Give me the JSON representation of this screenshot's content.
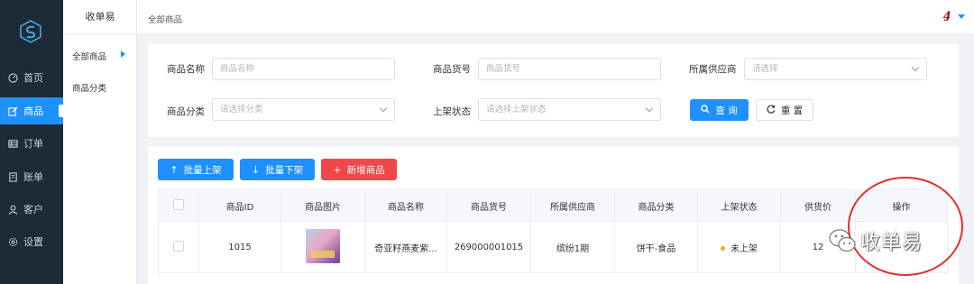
{
  "nav": {
    "items": [
      {
        "label": "首页",
        "icon": "dashboard-icon",
        "active": false
      },
      {
        "label": "商品",
        "icon": "edit-icon",
        "active": true
      },
      {
        "label": "订单",
        "icon": "list-icon",
        "active": false
      },
      {
        "label": "账单",
        "icon": "bill-icon",
        "active": false
      },
      {
        "label": "客户",
        "icon": "user-icon",
        "active": false
      },
      {
        "label": "设置",
        "icon": "settings-icon",
        "active": false
      }
    ]
  },
  "submenu": {
    "title": "收单易",
    "items": [
      "全部商品",
      "商品分类"
    ]
  },
  "topbar": {
    "breadcrumb": "全部商品"
  },
  "filters": {
    "name_label": "商品名称",
    "name_placeholder": "商品名称",
    "sku_label": "商品货号",
    "sku_placeholder": "商品货号",
    "supplier_label": "所属供应商",
    "supplier_placeholder": "请选择",
    "category_label": "商品分类",
    "category_placeholder": "请选择分类",
    "status_label": "上架状态",
    "status_placeholder": "请选择上架状态",
    "query_label": "查 询",
    "reset_label": "重 置"
  },
  "actions": {
    "batch_on": "批量上架",
    "batch_off": "批量下架",
    "add": "新增商品"
  },
  "table": {
    "headers": [
      "商品ID",
      "商品图片",
      "商品名称",
      "商品货号",
      "所属供应商",
      "商品分类",
      "上架状态",
      "供货价",
      "操作"
    ],
    "rows": [
      {
        "id": "1015",
        "name": "奇亚籽燕麦紫...",
        "sku": "269000001015",
        "supplier": "缤纷1期",
        "category": "饼干-食品",
        "status": "未上架",
        "price": "12"
      }
    ]
  },
  "watermark": "收单易",
  "colors": {
    "nav_bg": "#1c2b36",
    "primary": "#1e90ff",
    "danger": "#f04848",
    "status_dot": "#f5a623",
    "circle": "#e52d2d"
  }
}
